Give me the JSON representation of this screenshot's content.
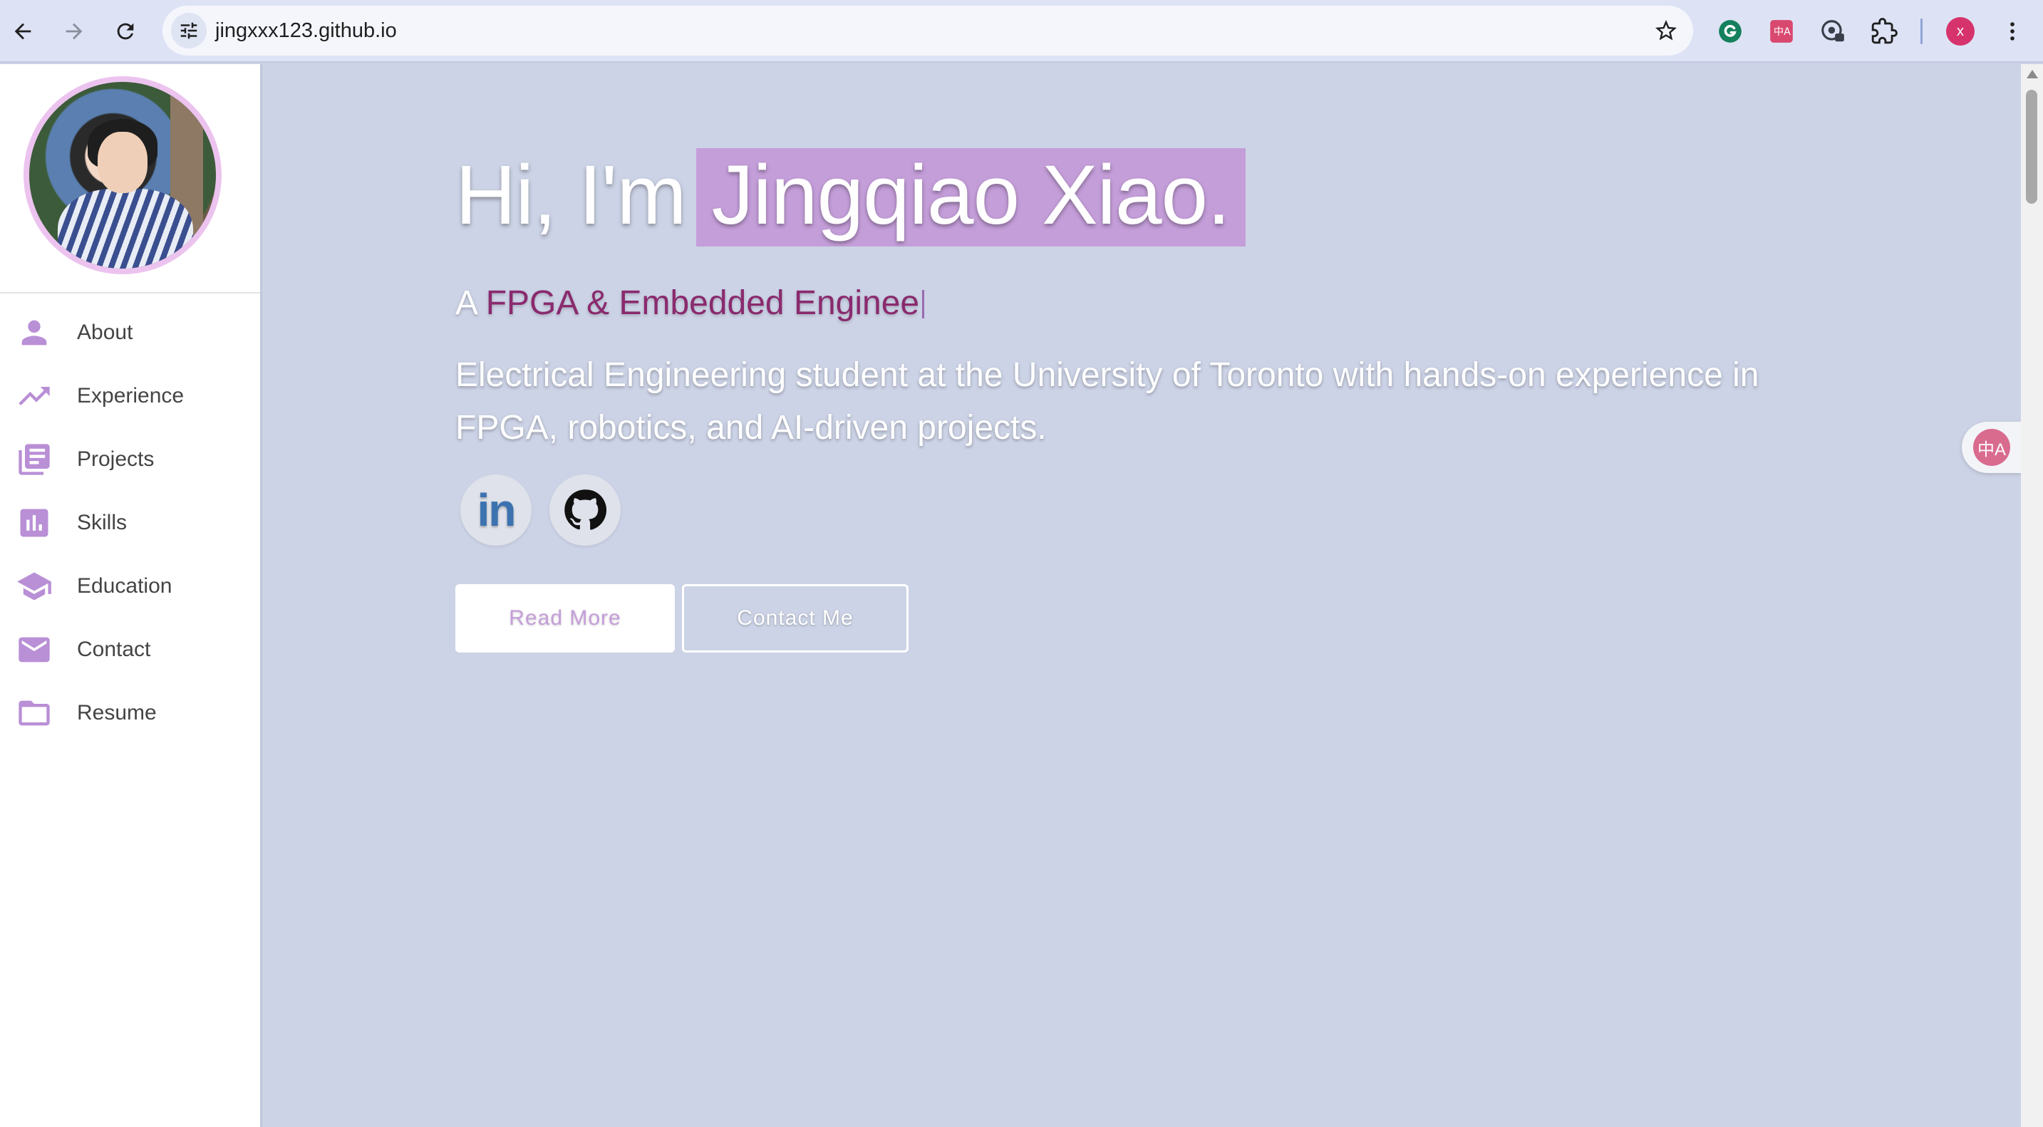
{
  "browser": {
    "url": "jingxxx123.github.io",
    "profile_initial": "x",
    "icons": {
      "back": "arrow-left-icon",
      "forward": "arrow-right-icon",
      "reload": "reload-icon",
      "site_info": "tune-icon",
      "bookmark": "star-icon",
      "ext1": "grammarly-icon",
      "ext2": "translate-icon",
      "ext3": "password-manager-icon",
      "extensions": "puzzle-icon",
      "menu": "more-vertical-icon"
    }
  },
  "sidebar": {
    "items": [
      {
        "label": "About",
        "icon": "person-icon"
      },
      {
        "label": "Experience",
        "icon": "trending-up-icon"
      },
      {
        "label": "Projects",
        "icon": "library-books-icon"
      },
      {
        "label": "Skills",
        "icon": "bar-chart-icon"
      },
      {
        "label": "Education",
        "icon": "graduation-cap-icon"
      },
      {
        "label": "Contact",
        "icon": "mail-icon"
      },
      {
        "label": "Resume",
        "icon": "folder-icon"
      }
    ]
  },
  "hero": {
    "greeting": "Hi, I'm",
    "name": "Jingqiao Xiao.",
    "subtitle_prefix": "A",
    "subtitle_role": "FPGA & Embedded Enginee",
    "description": "Electrical Engineering student at the University of Toronto with hands-on experience in FPGA, robotics, and AI-driven projects.",
    "linkedin_glyph": "in",
    "buttons": {
      "read_more": "Read More",
      "contact": "Contact Me"
    }
  },
  "float_widget": {
    "glyph": "中A"
  },
  "colors": {
    "accent": "#c49ed9",
    "page_bg": "#ccd3e6",
    "role_text": "#8a2a6e",
    "icon": "#b98fd6"
  }
}
